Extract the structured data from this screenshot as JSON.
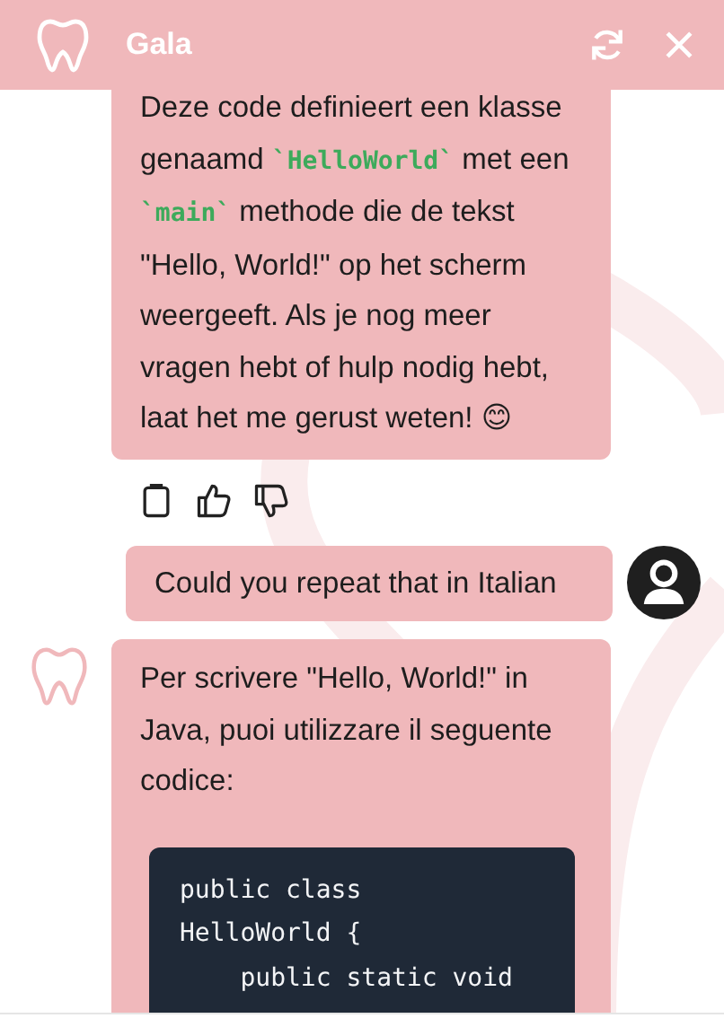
{
  "header": {
    "title": "Gala"
  },
  "messages": [
    {
      "kind": "bot",
      "avatar": false,
      "parts": [
        {
          "kind": "text",
          "text": "Deze code definieert een klasse genaamd "
        },
        {
          "kind": "code",
          "text": "`HelloWorld`"
        },
        {
          "kind": "text",
          "text": " met een "
        },
        {
          "kind": "code",
          "text": "`main`"
        },
        {
          "kind": "text",
          "text": " methode die de tekst \"Hello, World!\" op het scherm weergeeft. Als je nog meer vragen hebt of hulp nodig hebt, laat het me gerust weten! 😊"
        }
      ],
      "feedback": true
    },
    {
      "kind": "user",
      "avatar": true,
      "feedback": false,
      "parts": [
        {
          "kind": "text",
          "text": "Could you repeat that in Italian"
        }
      ]
    },
    {
      "kind": "bot",
      "avatar": true,
      "feedback": false,
      "parts": [
        {
          "kind": "text",
          "text": "Per scrivere \"Hello, World!\" in Java, puoi utilizzare il seguente codice:"
        }
      ],
      "code_block": "public class\nHelloWorld {\n    public static void"
    }
  ]
}
